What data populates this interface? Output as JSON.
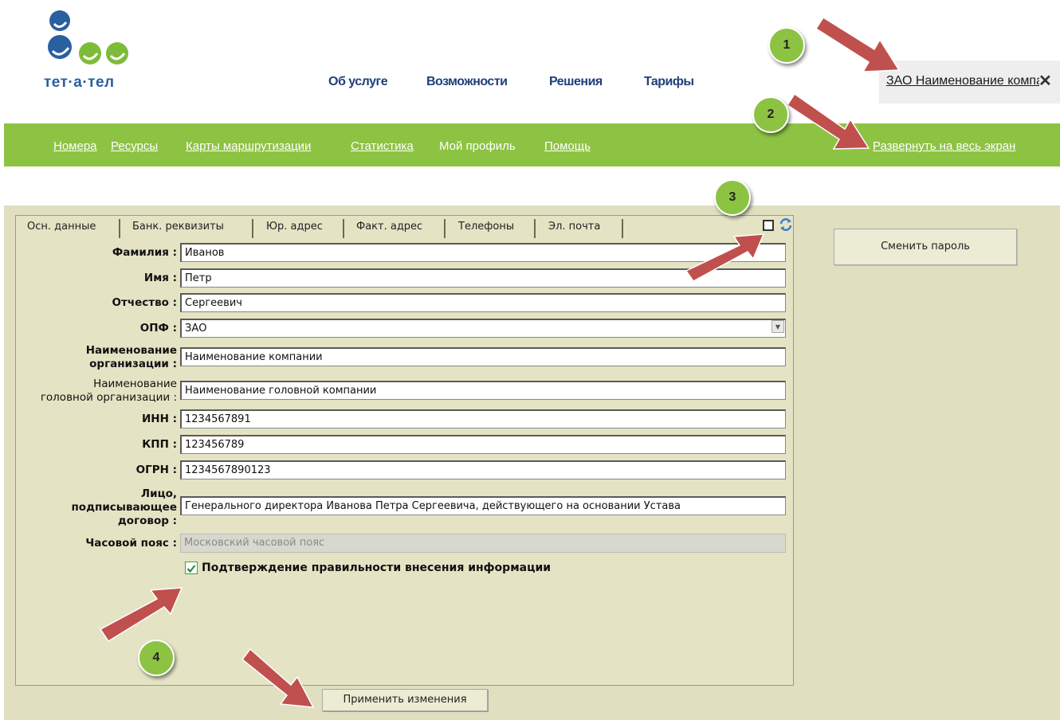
{
  "header": {
    "logo_text": "тет·а·тел",
    "nav": [
      "Об услуге",
      "Возможности",
      "Решения",
      "Тарифы"
    ],
    "company_link": "ЗАО Наименование компании",
    "close_glyph": "✕"
  },
  "green_nav": {
    "items": [
      "Номера",
      "Ресурсы",
      "Карты маршрутизации",
      "Статистика",
      "Мой профиль",
      "Помощь"
    ],
    "expand": "Развернуть на весь экран"
  },
  "tabs": [
    "Осн. данные",
    "Банк. реквизиты",
    "Юр. адрес",
    "Факт. адрес",
    "Телефоны",
    "Эл. почта"
  ],
  "form": {
    "surname_label": "Фамилия :",
    "surname": "Иванов",
    "name_label": "Имя :",
    "name": "Петр",
    "patronymic_label": "Отчество :",
    "patronymic": "Сергеевич",
    "opf_label": "ОПФ :",
    "opf": "ЗАО",
    "org_label_1": "Наименование",
    "org_label_2": "организации :",
    "org": "Наименование компании",
    "head_org_label_1": "Наименование",
    "head_org_label_2": "головной организации :",
    "head_org": "Наименование головной компании",
    "inn_label": "ИНН :",
    "inn": "1234567891",
    "kpp_label": "КПП :",
    "kpp": "123456789",
    "ogrn_label": "ОГРН :",
    "ogrn": "1234567890123",
    "signer_label_1": "Лицо,",
    "signer_label_2": "подписывающее",
    "signer_label_3": "договор  :",
    "signer": "Генерального директора Иванова Петра Сергеевича, действующего на основании Устава",
    "tz_label": "Часовой пояс :",
    "tz_placeholder": "Московский часовой пояс",
    "confirm_label": "Подтверждение правильности внесения информации",
    "confirm_checked": true,
    "apply_button": "Применить изменения"
  },
  "side": {
    "change_password": "Сменить пароль"
  },
  "callouts": [
    "1",
    "2",
    "3",
    "4"
  ],
  "colors": {
    "green": "#8dc342",
    "arrow": "#c0504d",
    "panel": "#e0dfbf",
    "nav_blue": "#1f3f7a"
  }
}
